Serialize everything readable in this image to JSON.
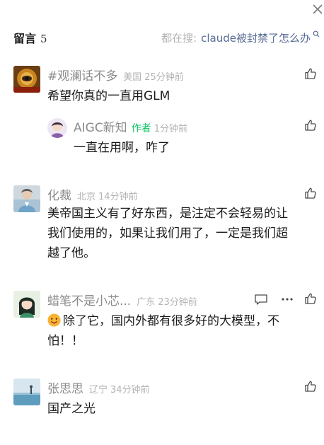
{
  "header": {
    "title": "留言",
    "count": "5",
    "search_prefix": "都在搜:",
    "search_term": "claude被封禁了怎么办"
  },
  "comments": [
    {
      "nickname": "#观澜话不多",
      "location": "美国",
      "time": "25分钟前",
      "content": "希望你真的一直用GLM",
      "reply": {
        "nickname": "AIGC新知",
        "author_tag": "作者",
        "time": "1分钟前",
        "content": "一直在用啊，咋了"
      }
    },
    {
      "nickname": "化裁",
      "location": "北京",
      "time": "14分钟前",
      "content_lines": [
        "美帝国主义有了好东西，是注定不会轻易的让",
        "我们使用的，如果让我们用了，一定是我们超",
        "越了他。"
      ]
    },
    {
      "nickname": "蜡笔不是小芯...",
      "location": "广东",
      "time": "23分钟前",
      "content_lines": [
        "除了它，国内外都有很多好的大模型，不",
        "怕！！"
      ]
    },
    {
      "nickname": "张思思",
      "location": "辽宁",
      "time": "34分钟前",
      "content": "国产之光"
    }
  ],
  "colors": {
    "nickname": "#8a8a8a",
    "meta": "#b2b2b2",
    "author_tag": "#07c160",
    "search_term": "#576b95",
    "text": "#1a1a1a"
  },
  "icons": [
    "close-icon",
    "search-icon",
    "thumbs-up-icon",
    "comment-icon",
    "more-icon",
    "tongue-emoji-icon"
  ]
}
